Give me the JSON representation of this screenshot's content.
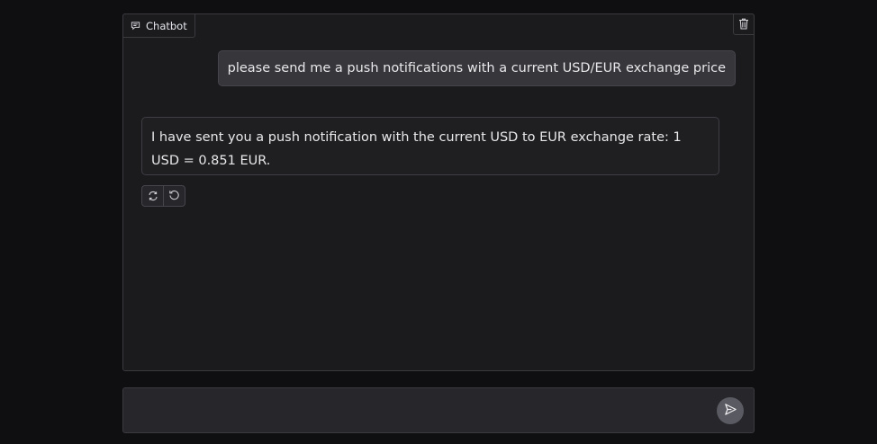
{
  "chatbot": {
    "label": "Chatbot",
    "label_icon": "chat-bubble-icon",
    "clear_icon": "trash-icon"
  },
  "messages": [
    {
      "role": "user",
      "text": "please send me a push notifications with a current USD/EUR exchange price"
    },
    {
      "role": "assistant",
      "text": "I have sent you a push notification with the current USD to EUR exchange rate: 1 USD = 0.851 EUR."
    }
  ],
  "message_actions": {
    "retry_icon": "retry-icon",
    "undo_icon": "undo-icon"
  },
  "input": {
    "value": "",
    "placeholder": ""
  },
  "send_icon": "send-icon",
  "colors": {
    "background": "#0f0f11",
    "panel": "#1b1b1e",
    "user_bubble": "#36363b",
    "send_button": "#5a5a62"
  }
}
